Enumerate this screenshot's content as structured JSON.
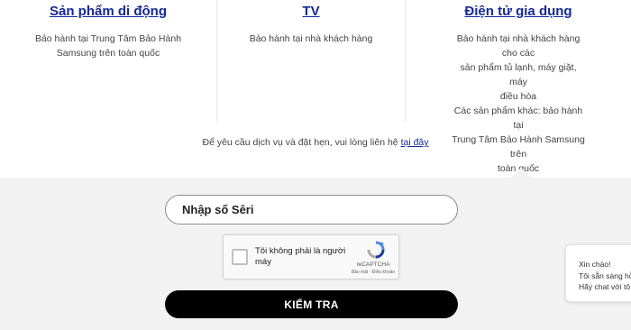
{
  "columns": [
    {
      "title": "Sản phẩm di động",
      "desc": [
        "Bảo hành tại Trung Tâm Bảo Hành",
        "Samsung trên toàn quốc"
      ]
    },
    {
      "title": "TV",
      "desc": [
        "Bảo hành tại nhà khách hàng"
      ]
    },
    {
      "title": "Điện tử gia dụng",
      "desc": [
        "Bảo hành tại nhà khách hàng cho các",
        "sản phẩm tủ lạnh, máy giặt, máy",
        "điều hòa",
        "Các sản phẩm khác: bảo hành tại",
        "Trung Tâm Bảo Hành Samsung trên",
        "toàn quốc"
      ]
    }
  ],
  "contact": {
    "text": "Để yêu cầu dịch vụ và đặt hẹn, vui lòng liên hệ",
    "link": "tại đây"
  },
  "serial_input": {
    "placeholder": "Nhập số Sêri",
    "value": ""
  },
  "captcha": {
    "label": "Tôi không phải là người máy",
    "brand": "reCAPTCHA",
    "terms": "Bảo mật - Điều khoản",
    "checked": false,
    "logo_icon": "recaptcha-logo-icon"
  },
  "check_button": {
    "label": "KIỂM TRA"
  },
  "chat_widget": {
    "lines": [
      "Xin chào!",
      "Tôi sẵn sàng hỗ",
      "Hãy chat với tô"
    ]
  },
  "colors": {
    "link_blue": "#1428a0",
    "button_black": "#000000",
    "panel_grey": "#f2f2f2"
  }
}
